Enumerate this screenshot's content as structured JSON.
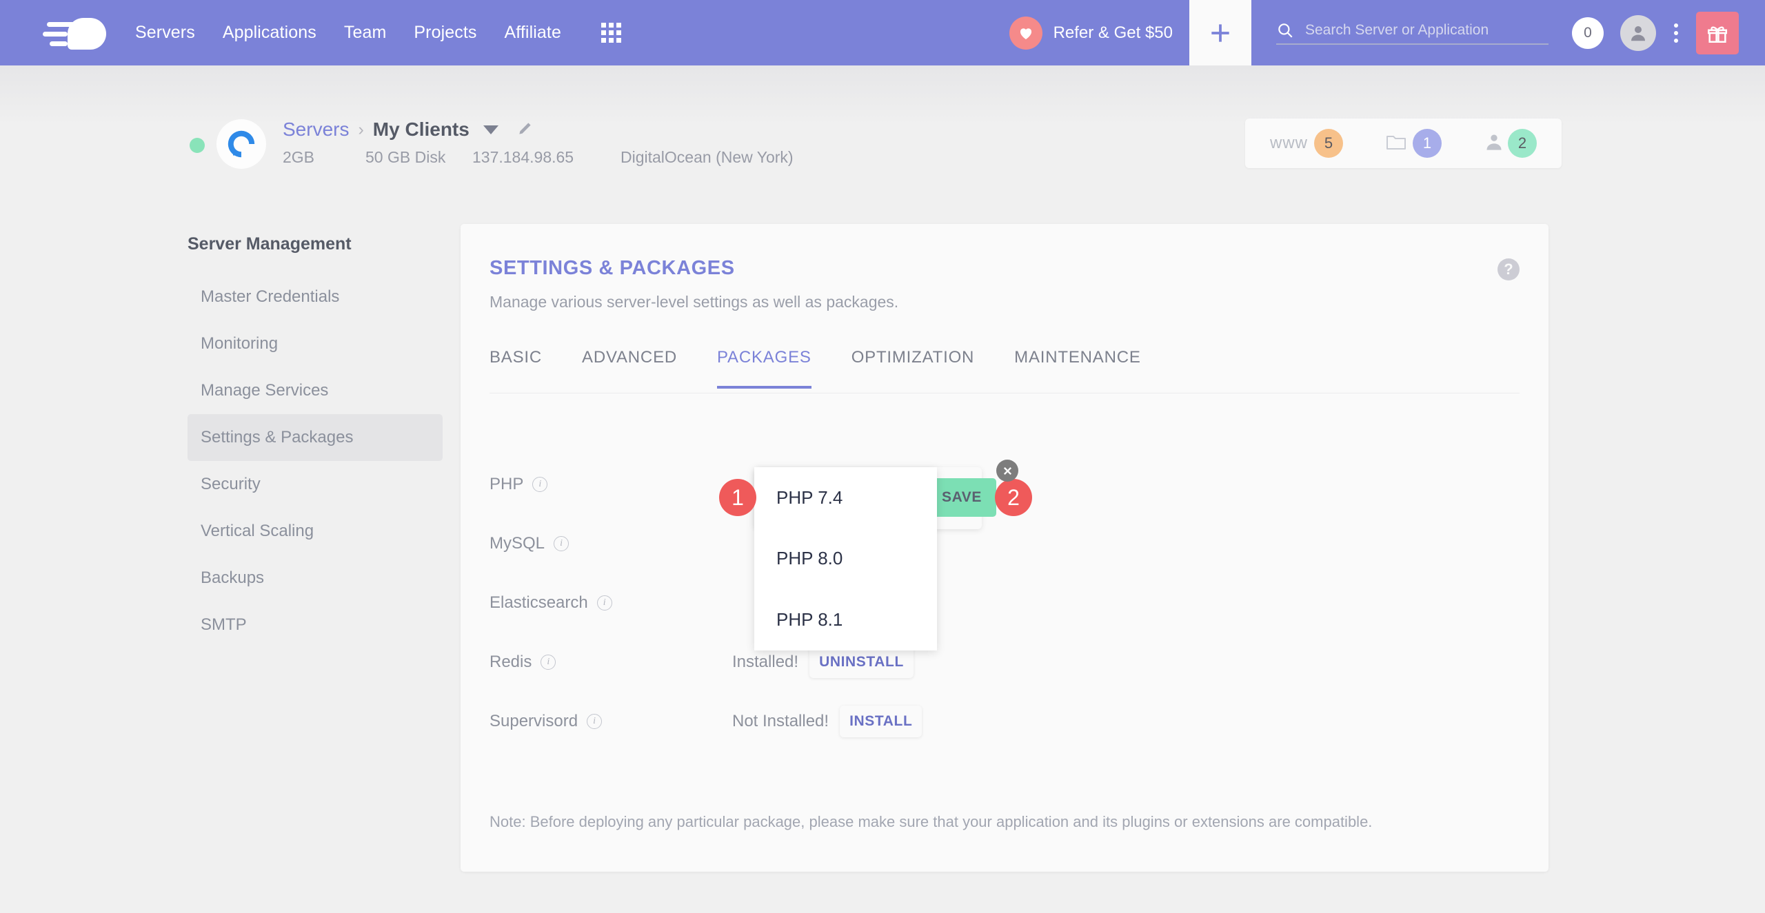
{
  "navbar": {
    "logo_name": "cloudways-logo",
    "links": [
      {
        "label": "Servers"
      },
      {
        "label": "Applications"
      },
      {
        "label": "Team"
      },
      {
        "label": "Projects"
      },
      {
        "label": "Affiliate"
      }
    ],
    "grid_icon": "apps-grid-icon",
    "refer_label": "Refer & Get $50",
    "plus_icon": "plus-icon",
    "search": {
      "placeholder": "Search Server or Application",
      "value": "",
      "icon": "search-icon"
    },
    "notification_count": "0",
    "avatar_icon": "user-avatar-icon",
    "kebab_icon": "vertical-dots-icon",
    "gift_icon": "gift-icon",
    "accent_color": "#7b82d8"
  },
  "server_header": {
    "status_color": "#89e3b9",
    "provider_icon": "digitalocean-logo",
    "breadcrumb_root": "Servers",
    "breadcrumb_sep": "›",
    "server_name": "My Clients",
    "caret_icon": "chevron-down-icon",
    "edit_icon": "pencil-icon",
    "ram": "2GB",
    "disk": "50 GB Disk",
    "ip": "137.184.98.65",
    "provider": "DigitalOcean (New York)",
    "stats": [
      {
        "icon": "www-icon",
        "label": "www",
        "count": "5",
        "color": "#f7c18a"
      },
      {
        "icon": "folder-icon",
        "label": "",
        "count": "1",
        "color": "#a7adea"
      },
      {
        "icon": "person-icon",
        "label": "",
        "count": "2",
        "color": "#9ae8c9"
      }
    ]
  },
  "sidebar": {
    "title": "Server Management",
    "items": [
      {
        "label": "Master Credentials",
        "active": false
      },
      {
        "label": "Monitoring",
        "active": false
      },
      {
        "label": "Manage Services",
        "active": false
      },
      {
        "label": "Settings & Packages",
        "active": true
      },
      {
        "label": "Security",
        "active": false
      },
      {
        "label": "Vertical Scaling",
        "active": false
      },
      {
        "label": "Backups",
        "active": false
      },
      {
        "label": "SMTP",
        "active": false
      }
    ]
  },
  "card": {
    "title": "SETTINGS & PACKAGES",
    "subtitle": "Manage various server-level settings as well as packages.",
    "help_icon": "question-mark-icon",
    "help_glyph": "?",
    "tabs": [
      {
        "label": "BASIC",
        "active": false
      },
      {
        "label": "ADVANCED",
        "active": false
      },
      {
        "label": "PACKAGES",
        "active": true
      },
      {
        "label": "OPTIMIZATION",
        "active": false
      },
      {
        "label": "MAINTENANCE",
        "active": false
      }
    ],
    "packages": [
      {
        "name": "PHP",
        "info_icon": "info-icon",
        "status": "",
        "action": ""
      },
      {
        "name": "MySQL",
        "info_icon": "info-icon",
        "status": "",
        "action": ""
      },
      {
        "name": "Elasticsearch",
        "info_icon": "info-icon",
        "status": "",
        "action": ""
      },
      {
        "name": "Redis",
        "info_icon": "info-icon",
        "status": "Installed!",
        "action": "UNINSTALL"
      },
      {
        "name": "Supervisord",
        "info_icon": "info-icon",
        "status": "Not Installed!",
        "action": "INSTALL"
      }
    ],
    "note": "Note: Before deploying any particular package, please make sure that your application and its plugins or extensions are compatible."
  },
  "overlay": {
    "save_label": "SAVE",
    "save_color": "#7cdfb4",
    "close_icon": "close-x-icon",
    "dropdown_options": [
      {
        "label": "PHP 7.4"
      },
      {
        "label": "PHP 8.0"
      },
      {
        "label": "PHP 8.1"
      }
    ],
    "markers": [
      {
        "number": "1",
        "color": "#ef5a5a"
      },
      {
        "number": "2",
        "color": "#ef5a5a"
      }
    ]
  }
}
